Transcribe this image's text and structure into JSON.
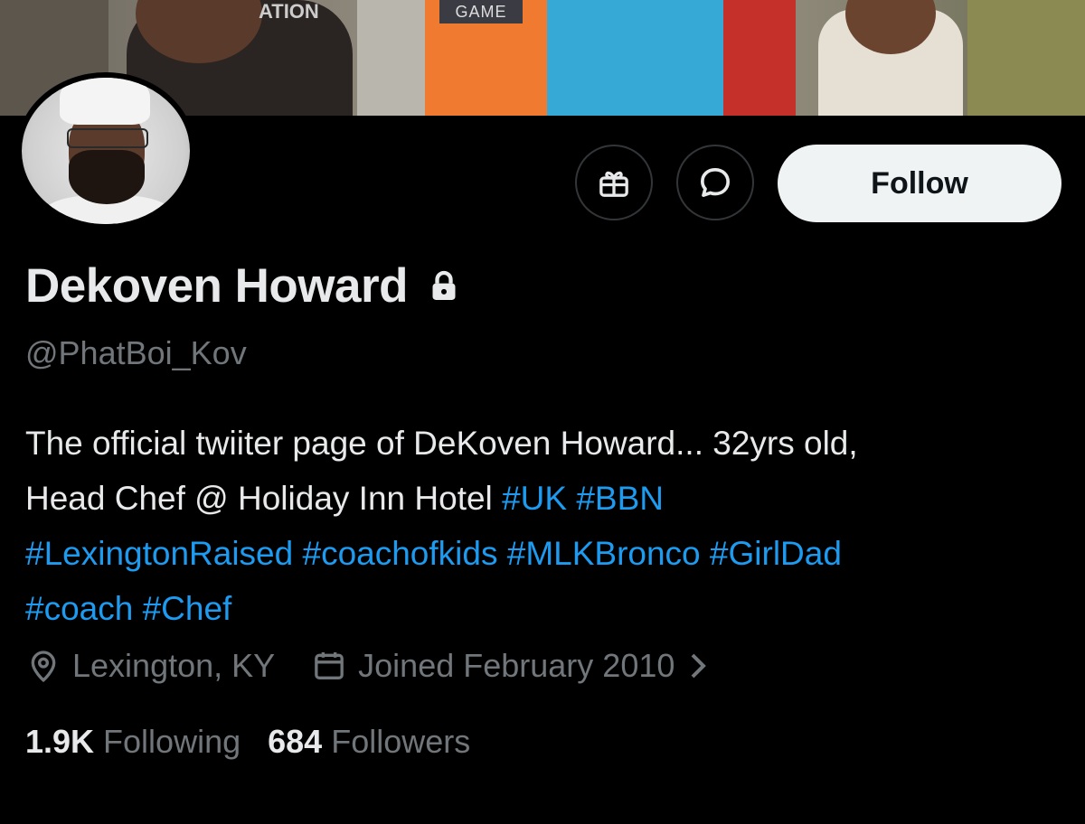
{
  "banner": {
    "shirt_text_1": "ATION",
    "shirt_text_2": "GAME"
  },
  "profile": {
    "display_name": "Dekoven Howard",
    "handle": "@PhatBoi_Kov",
    "protected_icon": "lock-icon"
  },
  "actions": {
    "gift_icon": "gift-icon",
    "message_icon": "message-icon",
    "follow_label": "Follow"
  },
  "bio": {
    "line1": "The official twiiter page of DeKoven Howard... 32yrs old,",
    "line2_text": "Head Chef @ Holiday Inn Hotel ",
    "line2_tags": [
      "#UK",
      "#BBN"
    ],
    "line3_tags": [
      "#LexingtonRaised",
      "#coachofkids",
      "#MLKBronco",
      "#GirlDad"
    ],
    "line4_tags": [
      "#coach",
      "#Chef"
    ]
  },
  "meta": {
    "location": "Lexington, KY",
    "location_icon": "location-pin-icon",
    "joined": "Joined February 2010",
    "joined_icon": "calendar-icon"
  },
  "stats": {
    "following_count": "1.9K",
    "following_label": "Following",
    "followers_count": "684",
    "followers_label": "Followers"
  },
  "colors": {
    "background": "#000000",
    "text_primary": "#e7e9ea",
    "text_secondary": "#71767b",
    "accent": "#1d9bf0",
    "follow_bg": "#eff3f4"
  }
}
